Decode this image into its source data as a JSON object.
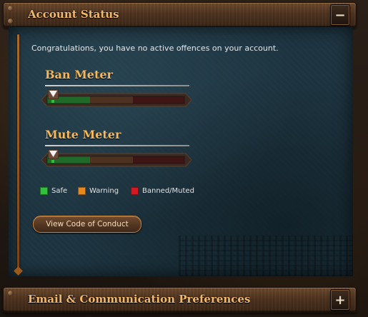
{
  "account_status": {
    "title": "Account Status",
    "toggle_symbol": "−",
    "message": "Congratulations, you have no active offences on your account."
  },
  "meters": [
    {
      "label": "Ban Meter",
      "level": 0
    },
    {
      "label": "Mute Meter",
      "level": 0
    }
  ],
  "legend": [
    {
      "label": "Safe",
      "color": "#2fc23a"
    },
    {
      "label": "Warning",
      "color": "#e8871e"
    },
    {
      "label": "Banned/Muted",
      "color": "#d31a22"
    }
  ],
  "conduct_button": {
    "label": "View Code of Conduct"
  },
  "email_prefs": {
    "title": "Email & Communication Preferences",
    "toggle_symbol": "+"
  },
  "colors": {
    "accent_text": "#f5b85a",
    "panel_bg": "#1d3440",
    "meter_safe": "#1f7a2a",
    "meter_warning": "#6a3a1e",
    "meter_banned": "#4a1515"
  }
}
